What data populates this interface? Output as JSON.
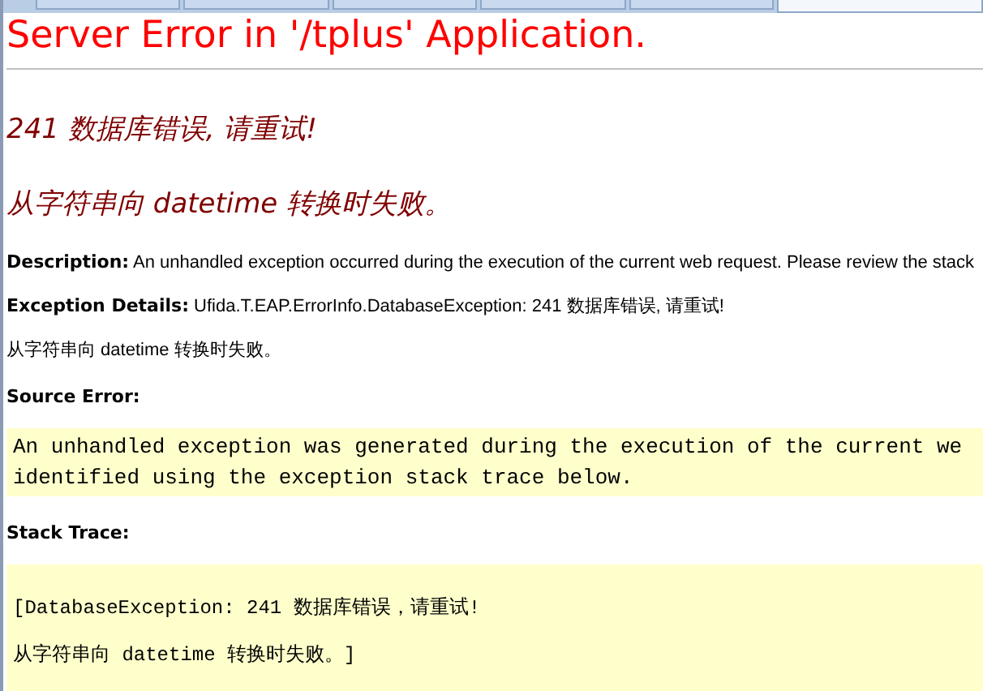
{
  "tabs": [
    {
      "selected": false
    },
    {
      "selected": false
    },
    {
      "selected": false
    },
    {
      "selected": false
    },
    {
      "selected": false
    },
    {
      "selected": true
    }
  ],
  "title": "Server Error in '/tplus' Application.",
  "error_heading": "241 数据库错误, 请重试!",
  "error_subheading": "从字符串向 datetime 转换时失败。",
  "details": [
    {
      "label": "Description:",
      "text": "An unhandled exception occurred during the execution of the current web request. Please review the stack"
    },
    {
      "label": "Exception Details:",
      "text": "Ufida.T.EAP.ErrorInfo.DatabaseException: 241 数据库错误, 请重试!"
    }
  ],
  "detail_note": "从字符串向  datetime 转换时失败。",
  "source_error": {
    "heading": "Source Error:",
    "message": "An unhandled exception was generated during the execution of the current we\nidentified using the exception stack trace below."
  },
  "stack_trace": {
    "heading": "Stack Trace:",
    "lines": [
      "[DatabaseException: 241 数据库错误，请重试!",
      "从字符串向 datetime 转换时失败。]"
    ]
  }
}
